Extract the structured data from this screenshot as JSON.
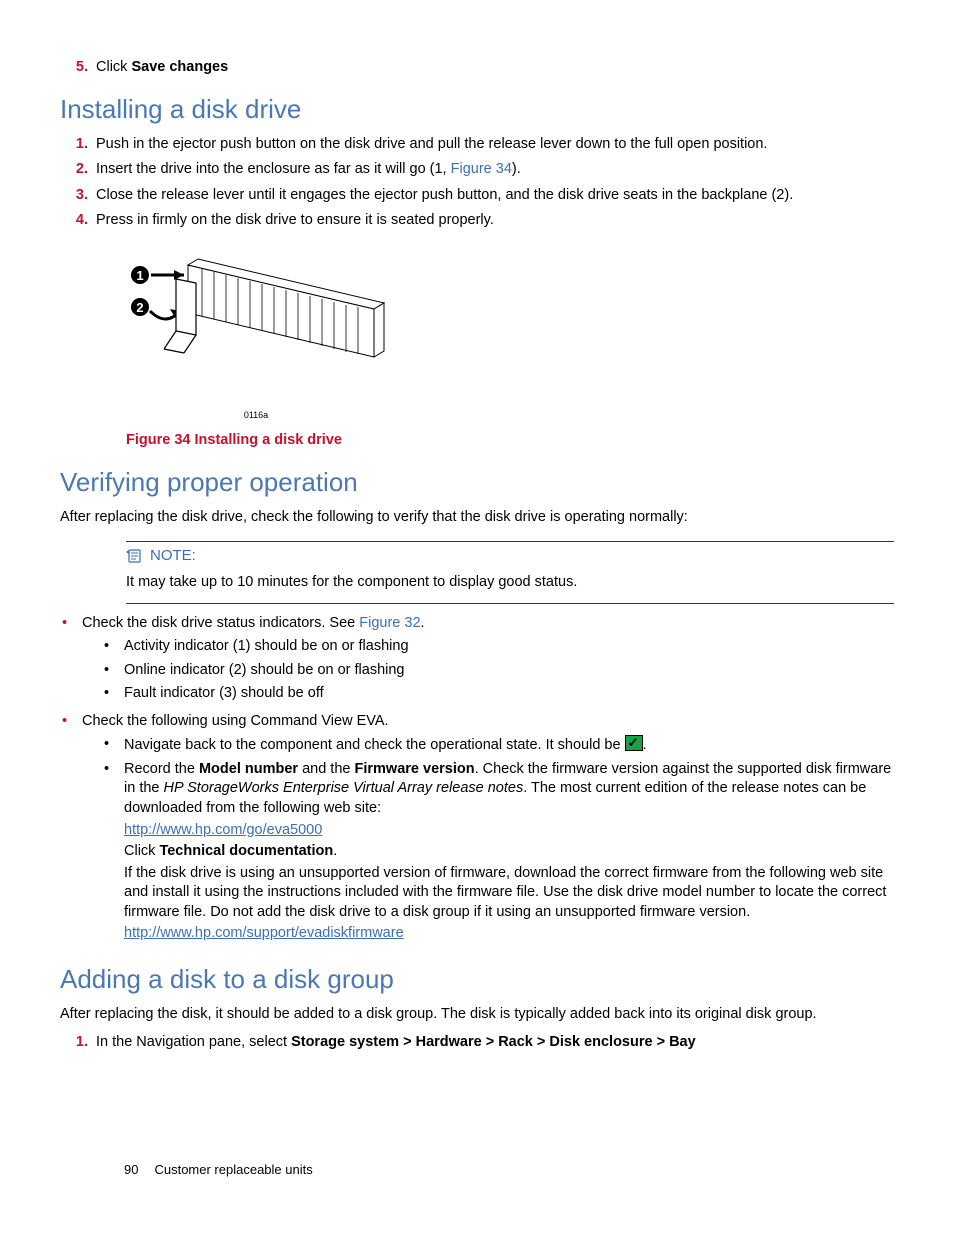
{
  "top_step": {
    "num": "5.",
    "prefix": "Click ",
    "bold": "Save changes"
  },
  "sec1": {
    "heading": "Installing a disk drive",
    "steps": [
      {
        "num": "1.",
        "text": "Push in the ejector push button on the disk drive and pull the release lever down to the full open position."
      },
      {
        "num": "2.",
        "pre": "Insert the drive into the enclosure as far as it will go (1, ",
        "xref": "Figure 34",
        "post": ")."
      },
      {
        "num": "3.",
        "text": "Close the release lever until it engages the ejector push button, and the disk drive seats in the backplane (2)."
      },
      {
        "num": "4.",
        "text": "Press in firmly on the disk drive to ensure it is seated properly."
      }
    ],
    "fig_code": "0116a",
    "fig_caption": "Figure 34 Installing a disk drive"
  },
  "sec2": {
    "heading": "Verifying proper operation",
    "intro": "After replacing the disk drive, check the following to verify that the disk drive is operating normally:",
    "note_label": "NOTE:",
    "note_text": "It may take up to 10 minutes for the component to display good status.",
    "b1_pre": "Check the disk drive status indicators.  See ",
    "b1_xref": "Figure 32",
    "b1_post": ".",
    "b1_sub": [
      "Activity indicator (1) should be on or flashing",
      "Online indicator (2) should be on or flashing",
      "Fault indicator (3) should be off"
    ],
    "b2": "Check the following using Command View EVA.",
    "b2_sub1": "Navigate back to the component and check the operational state.  It should be ",
    "b2_sub1_post": ".",
    "b2_sub2_a": "Record the ",
    "b2_sub2_b1": "Model number",
    "b2_sub2_c": " and the ",
    "b2_sub2_b2": "Firmware version",
    "b2_sub2_d": ".  Check the firmware version against the supported disk firmware in the ",
    "b2_sub2_i": "HP StorageWorks Enterprise Virtual Array release notes",
    "b2_sub2_e": ".  The most current edition of the release notes can be downloaded from the following web site:",
    "link1": "http://www.hp.com/go/eva5000",
    "tech_a": "Click ",
    "tech_b": "Technical documentation",
    "tech_c": ".",
    "fw_para": "If the disk drive is using an unsupported version of firmware, download the correct firmware from the following web site and install it using the instructions included with the firmware file. Use the disk drive model number to locate the correct firmware file. Do not add the disk drive to a disk group if it using an unsupported firmware version.",
    "link2": "http://www.hp.com/support/evadiskfirmware"
  },
  "sec3": {
    "heading": "Adding a disk to a disk group",
    "intro": "After replacing the disk, it should be added to a disk group. The disk is typically added back into its original disk group.",
    "step_num": "1.",
    "step_a": "In the Navigation pane, select ",
    "step_b": "Storage system > Hardware > Rack > Disk enclosure > Bay"
  },
  "footer": {
    "page": "90",
    "title": "Customer replaceable units"
  }
}
